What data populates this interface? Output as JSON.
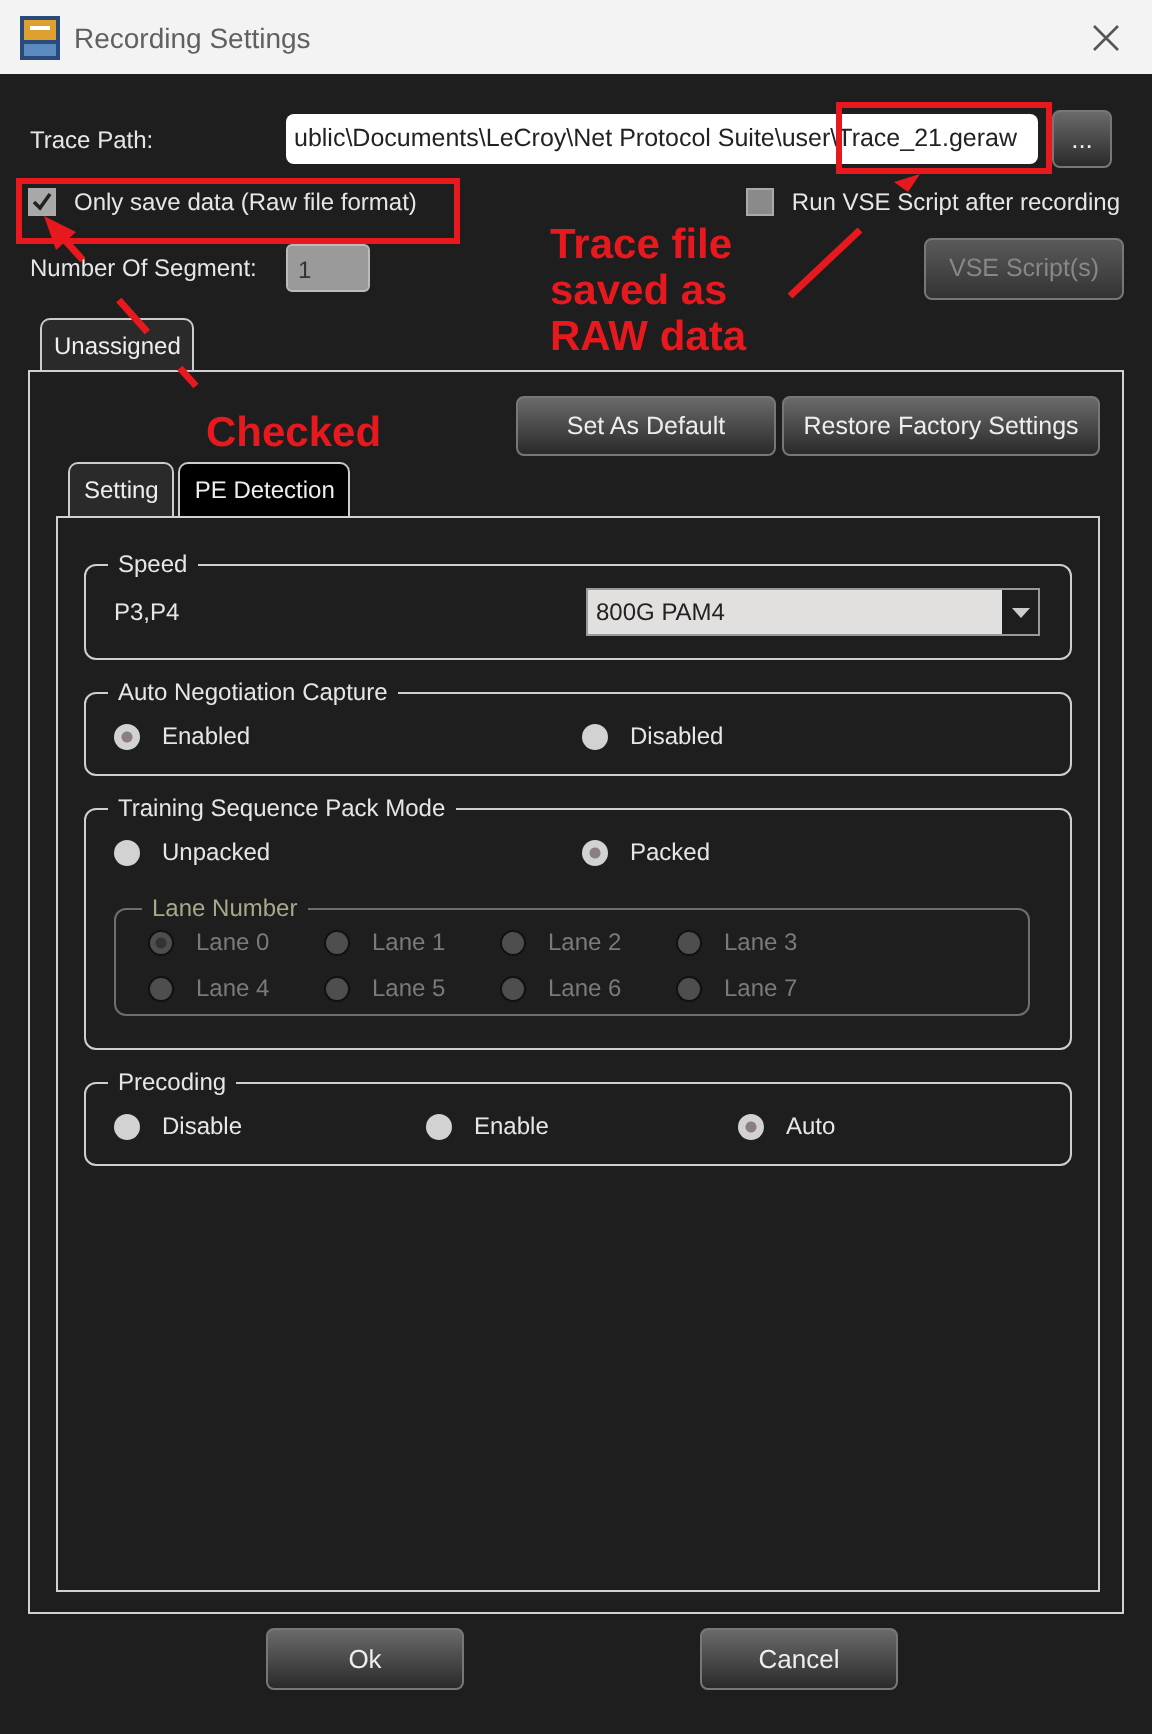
{
  "window": {
    "title": "Recording Settings"
  },
  "trace_path": {
    "label": "Trace Path:",
    "value": "ublic\\Documents\\LeCroy\\Net Protocol Suite\\user\\Trace_21.geraw"
  },
  "browse_button": {
    "label": "..."
  },
  "save_raw": {
    "label": "Only save data (Raw file format)",
    "checked": true
  },
  "run_vse": {
    "label": "Run VSE Script after recording",
    "checked": false
  },
  "segments": {
    "label": "Number Of Segment:",
    "value": "1",
    "disabled": true
  },
  "vse_button": {
    "label": "VSE Script(s)",
    "disabled": true
  },
  "outer_tabs": [
    {
      "label": "Unassigned",
      "selected": true
    }
  ],
  "panel_buttons": [
    "Set As Default",
    "Restore Factory Settings"
  ],
  "inner_tabs": [
    {
      "label": "Setting",
      "selected": true
    },
    {
      "label": "PE Detection",
      "selected": false
    }
  ],
  "sections": [
    {
      "kind": "dropdown",
      "title": "Speed",
      "label": "P3,P4",
      "value": "800G PAM4"
    },
    {
      "kind": "radios",
      "title": "Auto Negotiation Capture",
      "options": [
        {
          "label": "Enabled",
          "selected": true
        },
        {
          "label": "Disabled",
          "selected": false
        }
      ]
    },
    {
      "kind": "radios",
      "title": "Training Sequence Pack Mode",
      "options": [
        {
          "label": "Unpacked",
          "selected": false
        },
        {
          "label": "Packed",
          "selected": true
        }
      ],
      "subgroup": {
        "title": "Lane Number",
        "disabled": true,
        "options": [
          {
            "label": "Lane 0",
            "selected": true
          },
          {
            "label": "Lane 1",
            "selected": false
          },
          {
            "label": "Lane 2",
            "selected": false
          },
          {
            "label": "Lane 3",
            "selected": false
          },
          {
            "label": "Lane 4",
            "selected": false
          },
          {
            "label": "Lane 5",
            "selected": false
          },
          {
            "label": "Lane 6",
            "selected": false
          },
          {
            "label": "Lane 7",
            "selected": false
          }
        ]
      }
    },
    {
      "kind": "radios",
      "title": "Precoding",
      "options": [
        {
          "label": "Disable",
          "selected": false
        },
        {
          "label": "Enable",
          "selected": false
        },
        {
          "label": "Auto",
          "selected": true
        }
      ]
    }
  ],
  "footer_buttons": [
    "Ok",
    "Cancel"
  ],
  "annotations": [
    {
      "text": "Trace file saved as RAW data"
    },
    {
      "text": "Checked"
    }
  ]
}
